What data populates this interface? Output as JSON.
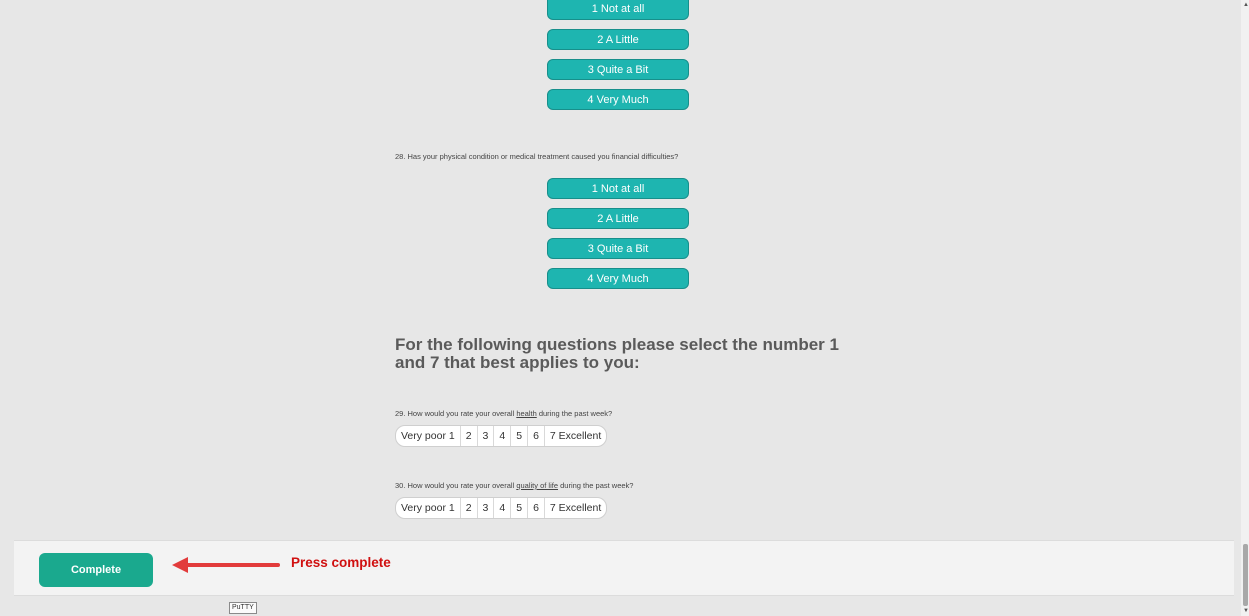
{
  "q27": {
    "options": [
      "1 Not at all",
      "2 A Little",
      "3 Quite a Bit",
      "4 Very Much"
    ]
  },
  "q28": {
    "text": "28. Has your physical condition or medical treatment caused you financial difficulties?",
    "options": [
      "1 Not at all",
      "2 A Little",
      "3 Quite a Bit",
      "4 Very Much"
    ]
  },
  "section": {
    "heading": "For the following questions please select the number 1 and 7 that best applies to you:"
  },
  "q29": {
    "prefix": "29. How would you rate your overall ",
    "emphasis": "health",
    "suffix": " during the past week?",
    "scale": [
      "Very poor 1",
      "2",
      "3",
      "4",
      "5",
      "6",
      "7 Excellent"
    ]
  },
  "q30": {
    "prefix": "30. How would you rate your overall ",
    "emphasis": "quality of life",
    "suffix": " during the past week?",
    "scale": [
      "Very poor 1",
      "2",
      "3",
      "4",
      "5",
      "6",
      "7 Excellent"
    ]
  },
  "footer": {
    "complete_label": "Complete",
    "annotation": "Press complete"
  },
  "taskbar": {
    "tooltip": "PuTTY"
  },
  "colors": {
    "accent": "#1eb5b0",
    "complete": "#1aa98e",
    "annotation": "#d01010"
  }
}
